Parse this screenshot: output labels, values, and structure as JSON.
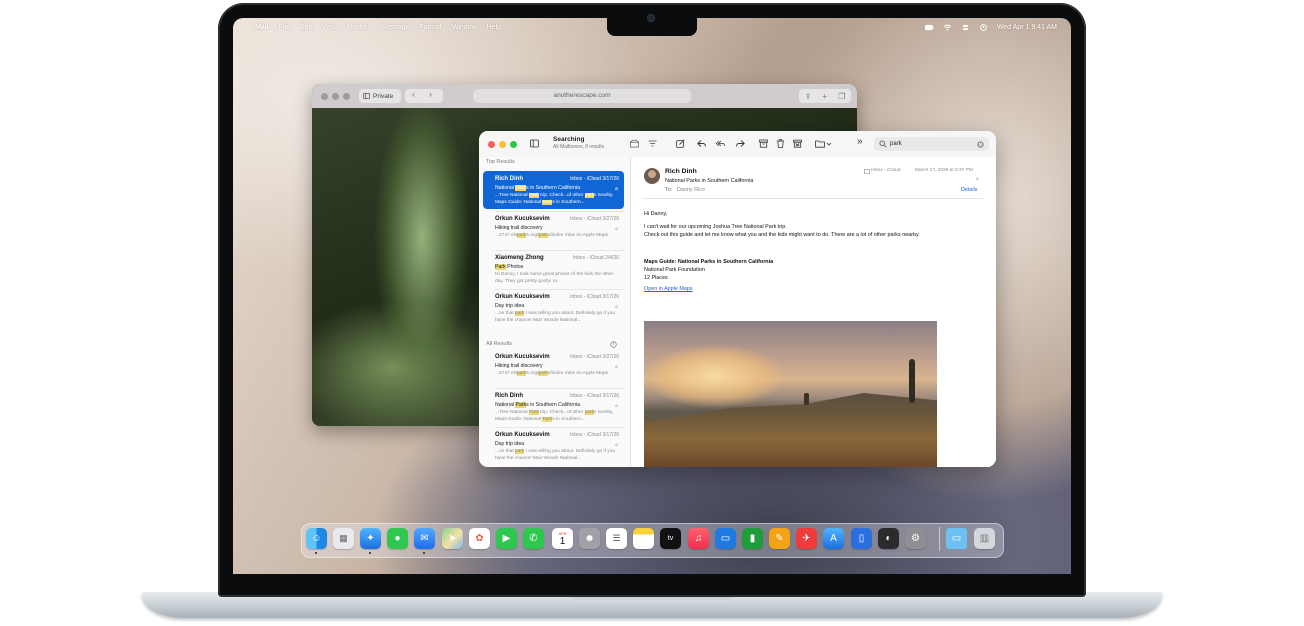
{
  "menubar": {
    "apple_glyph": "",
    "app_name": "Mail",
    "items": [
      "File",
      "Edit",
      "View",
      "Mailbox",
      "Message",
      "Format",
      "Window",
      "Help"
    ],
    "clock": "Wed Apr 1  9:41 AM"
  },
  "safari": {
    "tab_label": "Private",
    "address": "anotherescape.com"
  },
  "mail": {
    "toolbar": {
      "title": "Searching",
      "subtitle": "All Mailboxes, 8 results",
      "search_value": "park"
    },
    "sections": {
      "top": "Top Results",
      "all": "All Results"
    },
    "messages": [
      {
        "sender": "Rich Dinh",
        "meta": "Inbox - iCloud   3/17/26",
        "subject": "National Parks in Southern California",
        "snippet": "...Tree National Park trip. Check...of other parks nearby. Maps Guide: National Parks in Southern..."
      },
      {
        "sender": "Orkun Kucuksevim",
        "meta": "Inbox - iCloud   3/27/26",
        "subject": "Hiking trail discovery",
        "snippet": "...2747 elsparks.org/parks/hiden View on Apple Maps"
      },
      {
        "sender": "Xiaomeng Zhong",
        "meta": "Inbox - iCloud   2/4/26",
        "subject": "Park Photos",
        "snippet": "Hi Danny, I took some great photos of the kids the other day. They got pretty goofy! xx"
      },
      {
        "sender": "Orkun Kucuksevim",
        "meta": "Inbox - iCloud   3/17/26",
        "subject": "Day trip idea",
        "snippet": "...on that park I was telling you about. Definitely go if you have the chance! Muir Woods National..."
      },
      {
        "sender": "Orkun Kucuksevim",
        "meta": "Inbox - iCloud   3/27/26",
        "subject": "Hiking trail discovery",
        "snippet": "...2747 elsparks.org/parks/hiden View on Apple Maps"
      },
      {
        "sender": "Rich Dinh",
        "meta": "Inbox - iCloud   3/17/26",
        "subject": "National Parks in Southern California",
        "snippet": "...Tree National Park trip. Check...of other parks nearby. Maps Guide: National Parks in Southern..."
      },
      {
        "sender": "Orkun Kucuksevim",
        "meta": "Inbox - iCloud   3/17/26",
        "subject": "Day trip idea",
        "snippet": "...on that park I was telling you about. Definitely go if you have the chance! Muir Woods National..."
      }
    ],
    "reader": {
      "from": "Rich Dinh",
      "subject": "National Parks in Southern California",
      "to_label": "To:",
      "to": "Danny Rico",
      "mailbox": "Inbox - iCloud",
      "date": "March 17, 2026 at 6:37 PM",
      "details": "Details",
      "greeting": "Hi Danny,",
      "body1": "I can't wait for our upcoming Joshua Tree National Park trip.",
      "body2": "Check out this guide and let me know what you and the kids might want to do. There are a lot of other parks nearby.",
      "guide_title": "Maps Guide: National Parks in Southern California",
      "guide_org": "National Park Foundation",
      "guide_places": "12 Places",
      "guide_link": "Open in Apple Maps"
    }
  },
  "dock": {
    "calendar_month": "APR",
    "calendar_day": "1",
    "tv_label": "tv",
    "icons": [
      "finder-icon",
      "launchpad-icon",
      "safari-icon",
      "messages-icon",
      "mail-icon",
      "maps-icon",
      "photos-icon",
      "facetime-icon",
      "phone-icon",
      "calendar-icon",
      "contacts-icon",
      "reminders-icon",
      "notes-icon",
      "apple-tv-icon",
      "music-icon",
      "keynote-icon",
      "numbers-icon",
      "pages-icon",
      "testflight-icon",
      "app-store-icon",
      "simulator-icon",
      "screen-time-icon",
      "system-settings-icon",
      "downloads-folder-icon",
      "trash-icon"
    ]
  },
  "colors": {
    "accent": "#1166d6",
    "highlight": "#e9d873",
    "link": "#1a66d2"
  }
}
